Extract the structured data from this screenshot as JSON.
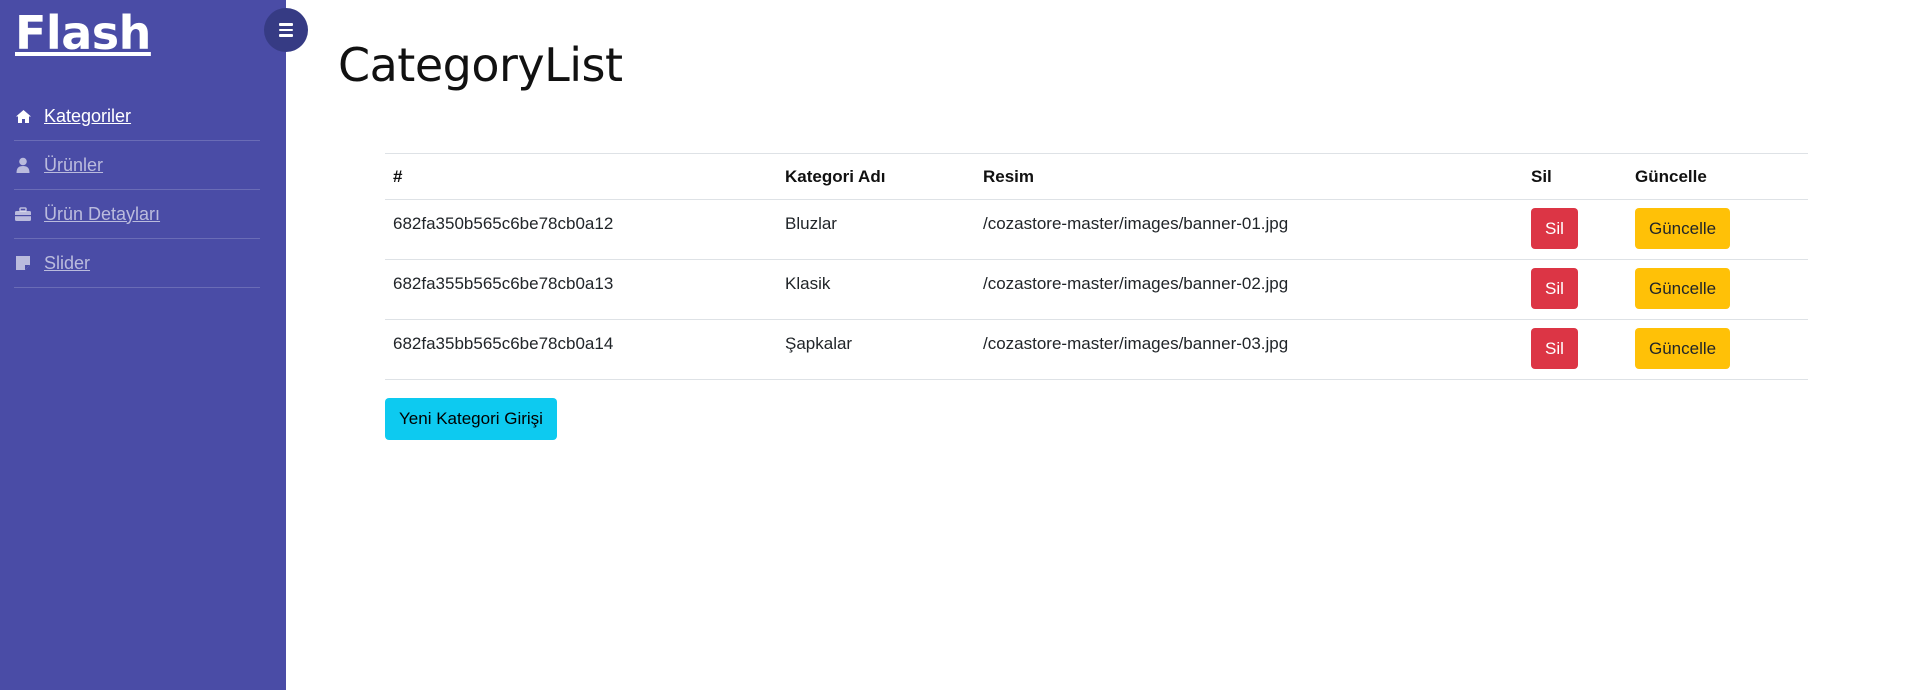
{
  "sidebar": {
    "brand": "Flash",
    "items": [
      {
        "label": "Kategoriler",
        "icon": "home-icon",
        "active": true
      },
      {
        "label": "Ürünler",
        "icon": "user-icon",
        "active": false
      },
      {
        "label": "Ürün Detayları",
        "icon": "briefcase-icon",
        "active": false
      },
      {
        "label": "Slider",
        "icon": "sticky-note-icon",
        "active": false
      }
    ]
  },
  "header": {
    "title": "CategoryList"
  },
  "table": {
    "columns": [
      "#",
      "Kategori Adı",
      "Resim",
      "Sil",
      "Güncelle"
    ],
    "rows": [
      {
        "id": "682fa350b565c6be78cb0a12",
        "name": "Bluzlar",
        "image": "/cozastore-master/images/banner-01.jpg",
        "delete": "Sil",
        "update": "Güncelle"
      },
      {
        "id": "682fa355b565c6be78cb0a13",
        "name": "Klasik",
        "image": "/cozastore-master/images/banner-02.jpg",
        "delete": "Sil",
        "update": "Güncelle"
      },
      {
        "id": "682fa35bb565c6be78cb0a14",
        "name": "Şapkalar",
        "image": "/cozastore-master/images/banner-03.jpg",
        "delete": "Sil",
        "update": "Güncelle"
      }
    ]
  },
  "actions": {
    "new_category": "Yeni Kategori Girişi"
  },
  "colors": {
    "sidebar_bg": "#4a4ca6",
    "toggle_bg": "#363b84",
    "danger": "#dc3545",
    "warning": "#ffc107",
    "info": "#0dcaf0"
  }
}
